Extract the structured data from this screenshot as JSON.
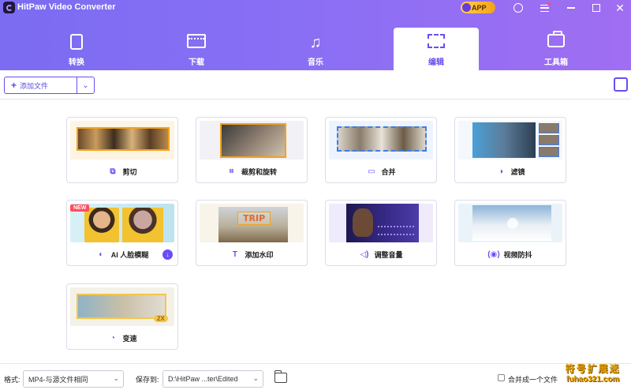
{
  "app": {
    "title": "HitPaw Video Converter",
    "badge": "APP"
  },
  "tabs": [
    {
      "label": "转换",
      "icon": "convert-icon"
    },
    {
      "label": "下载",
      "icon": "download-icon"
    },
    {
      "label": "音乐",
      "icon": "music-icon"
    },
    {
      "label": "编辑",
      "icon": "edit-icon",
      "active": true
    },
    {
      "label": "工具箱",
      "icon": "toolbox-icon"
    }
  ],
  "toolbar": {
    "add_file_label": "添加文件"
  },
  "features": [
    {
      "label": "剪切",
      "icon": "cut-icon"
    },
    {
      "label": "裁剪和旋转",
      "icon": "crop-icon"
    },
    {
      "label": "合并",
      "icon": "merge-icon"
    },
    {
      "label": "滤镜",
      "icon": "filter-icon"
    },
    {
      "label": "AI 人脸模糊",
      "icon": "face-blur-icon",
      "badge": "NEW"
    },
    {
      "label": "添加水印",
      "icon": "watermark-icon",
      "overlay_text": "TRIP"
    },
    {
      "label": "调整音量",
      "icon": "volume-icon"
    },
    {
      "label": "视频防抖",
      "icon": "stabilize-icon"
    },
    {
      "label": "变速",
      "icon": "speed-icon",
      "overlay_text": "2X"
    }
  ],
  "bottom": {
    "format_label": "格式:",
    "format_value": "MP4-与源文件相同",
    "save_label": "保存到:",
    "save_value": "D:\\HitPaw ...ter\\Edited",
    "merge_label": "合并成一个文件"
  },
  "watermark": {
    "line1": "符号扩展迷",
    "line2": "fuhao321.com"
  },
  "colors": {
    "accent": "#6a4df5",
    "header_start": "#7b6cf2",
    "header_end": "#a06ef2"
  }
}
